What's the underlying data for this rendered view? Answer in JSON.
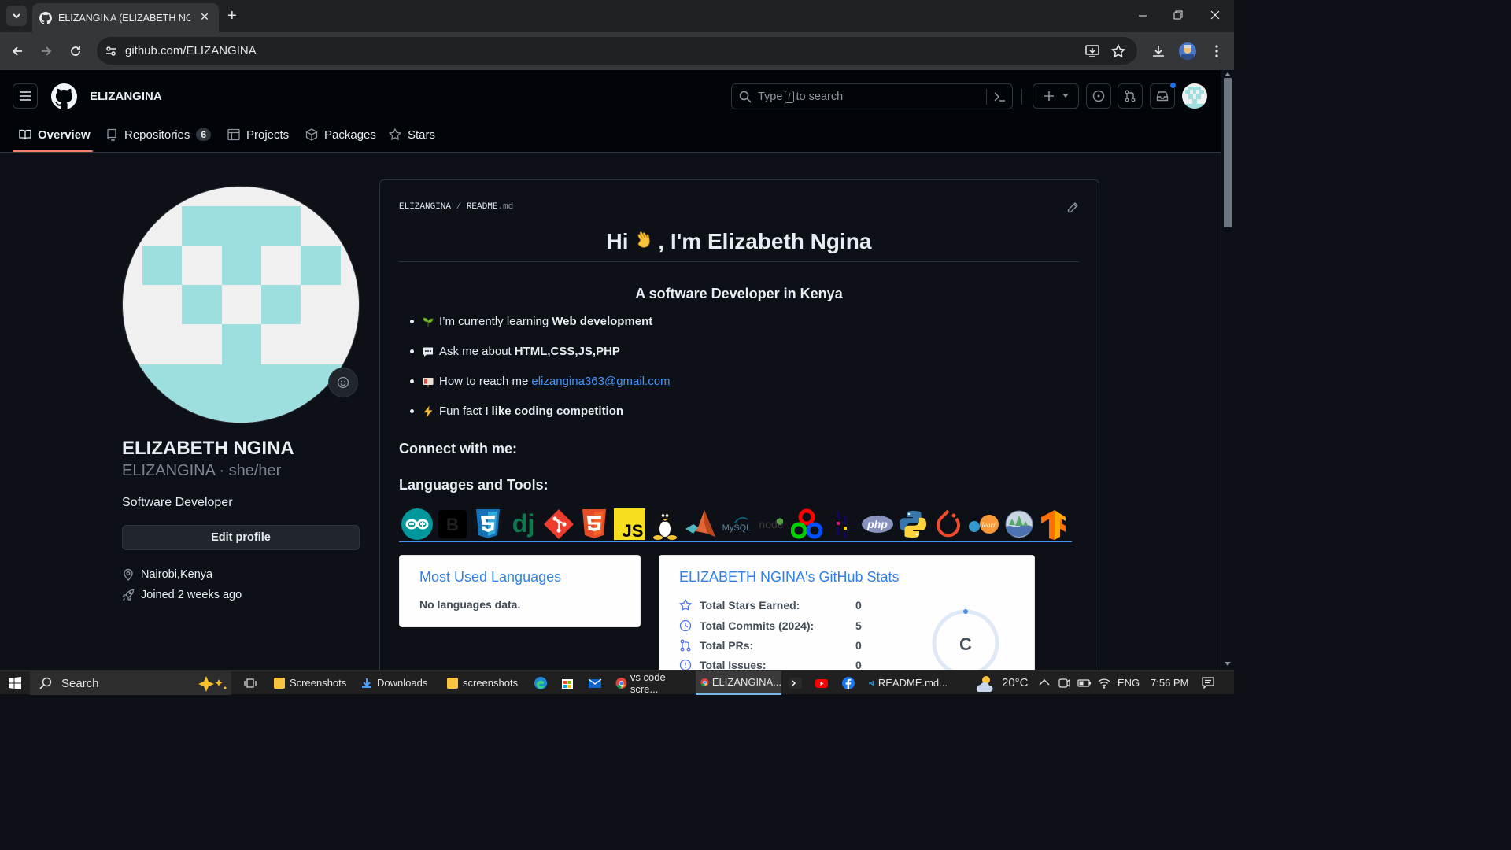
{
  "browser": {
    "tab_title": "ELIZANGINA (ELIZABETH NGINA)",
    "url": "github.com/ELIZANGINA",
    "new_tab": "+",
    "close_tab": "✕"
  },
  "header": {
    "username": "ELIZANGINA",
    "search_text": "Type",
    "search_key": "/",
    "search_suffix": "to search"
  },
  "nav": {
    "tabs": [
      {
        "label": "Overview"
      },
      {
        "label": "Repositories",
        "count": "6"
      },
      {
        "label": "Projects"
      },
      {
        "label": "Packages"
      },
      {
        "label": "Stars"
      }
    ]
  },
  "profile": {
    "full_name": "ELIZABETH NGINA",
    "login": "ELIZANGINA",
    "pronouns": " · she/her",
    "bio": "Software Developer",
    "edit_label": "Edit profile",
    "location": "Nairobi,Kenya",
    "joined": "Joined 2 weeks ago"
  },
  "readme": {
    "path_owner": "ELIZANGINA",
    "path_sep": " / ",
    "path_file": "README",
    "path_ext": ".md",
    "heading_pre": "Hi ",
    "heading_post": ", I'm Elizabeth Ngina",
    "subtitle": "A software Developer in Kenya",
    "items": [
      {
        "text": "I’m currently learning",
        "bold": "Web development"
      },
      {
        "text": "Ask me about",
        "bold": "HTML,CSS,JS,PHP"
      },
      {
        "text": "How to reach me",
        "link": "elizangina363@gmail.com"
      },
      {
        "text": "Fun fact",
        "bold": "I like coding competition"
      }
    ],
    "connect_heading": "Connect with me:",
    "tools_heading": "Languages and Tools:",
    "tools": [
      "arduino",
      "bootstrap",
      "css3",
      "django",
      "git",
      "html5",
      "javascript",
      "linux",
      "matlab",
      "mysql",
      "nodejs",
      "opencv",
      "pandas",
      "php",
      "python",
      "pytorch",
      "scikit-learn",
      "seaborn",
      "tensorflow"
    ],
    "tool_labels": {
      "bootstrap": "B",
      "django": "dj",
      "javascript": "JS",
      "mysql": "MySQL",
      "nodejs": "node",
      "php": "php"
    }
  },
  "cards": {
    "languages": {
      "title": "Most Used Languages",
      "text": "No languages data."
    },
    "stats": {
      "title": "ELIZABETH NGINA's GitHub Stats",
      "rows": [
        {
          "label": "Total Stars Earned:",
          "value": "0"
        },
        {
          "label": "Total Commits (2024):",
          "value": "5"
        },
        {
          "label": "Total PRs:",
          "value": "0"
        },
        {
          "label": "Total Issues:",
          "value": "0"
        }
      ],
      "grade": "C"
    }
  },
  "taskbar": {
    "search": "Search",
    "apps": [
      {
        "label": "Screenshots"
      },
      {
        "label": "Downloads"
      },
      {
        "label": "screenshots"
      },
      {
        "label": "vs code scre..."
      },
      {
        "label": "ELIZANGINA..."
      },
      {
        "label": "README.md..."
      }
    ],
    "temp": "20°C",
    "lang": "ENG",
    "time": "7:56 PM"
  },
  "colors": {
    "accent_blue": "#4493f8",
    "avatar_teal": "#9ddedf",
    "tab_underline": "#f78166",
    "card_title": "#2f80ed"
  }
}
